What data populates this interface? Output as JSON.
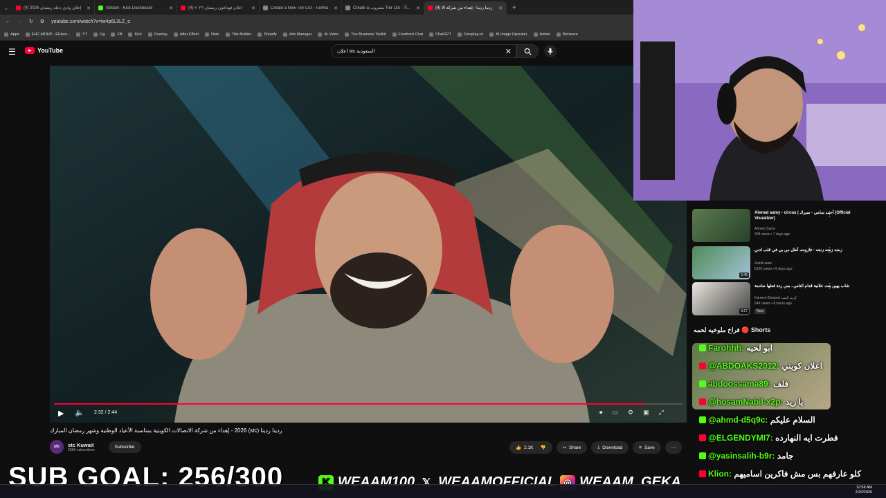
{
  "browser": {
    "tabs": [
      {
        "label": "(4) إعلان وادي دجلة رمضان 2026",
        "color": "#ff0033",
        "active": false
      },
      {
        "label": "Stream - Kick Dashboard",
        "color": "#53fc18",
        "active": false
      },
      {
        "label": "(4) اعلان فودافون رمضان ٢٠٢٦",
        "color": "#ff0033",
        "active": false
      },
      {
        "label": "Create a New Tier List - TierMa",
        "color": "#888888",
        "active": false
      },
      {
        "label": "Create a مشروب Tier List - TierM",
        "color": "#888888",
        "active": false
      },
      {
        "label": "(4) ردينا ردينا - إهداء من شركة الا",
        "color": "#ff0033",
        "active": true
      }
    ],
    "url": "youtube.com/watch?v=iw4p6L3LZ_o",
    "bookmarks": [
      "Apps",
      "EHC-MOHP - EEtest...",
      "YT",
      "Gg",
      "FB",
      "Kick",
      "Overlay",
      "After Effect",
      "Note",
      "Title Builder",
      "Shopify",
      "Ads Manager",
      "AI Video",
      "The Business Toolkit",
      "Forefront Chat",
      "ChatGPT",
      "Foreplay.co",
      "AI Image Upscaler",
      "Anime",
      "Behance"
    ]
  },
  "youtube": {
    "logo": "YouTube",
    "search_value": "اعلان stc السعودية",
    "player": {
      "time": "2:32 / 2:44",
      "progress": 0.94
    },
    "video_title": "ردينا ردينا (stc) 2026 - إهداء من شركة الاتصالات الكويتية بمناسبة الأعياد الوطنية وشهر رمضان المبارك",
    "channel": {
      "name": "stc Kuwait",
      "subscribers": "258K subscribers",
      "subscribe_label": "Subscribe"
    },
    "actions": {
      "likes": "2.1K",
      "share": "Share",
      "download": "Download",
      "save": "Save"
    },
    "recommendations": [
      {
        "title": "Ahmed samy - circus | أحمد سامي - سيرك (Official Visualizer)",
        "channel": "Ahmed Samy",
        "meta": "328 views • 7 days ago",
        "duration": ""
      },
      {
        "title": "زنجه زنجه زنجه - فازونت أطل من بي في قلب ادني",
        "channel": "ZainKuwait",
        "meta": "612K views • 8 days ago",
        "duration": "2:45"
      },
      {
        "title": "شاب يهين بنت علانية قدام الناس.. بس ردة فعلها صادمة",
        "channel": "Kareem Elsayed كريم السيد",
        "meta": "54K views • 8 hours ago",
        "duration": "9:27",
        "badge": "New"
      }
    ]
  },
  "chat": {
    "header": "فراخ ملوخيه لحمه 🔴 Shorts",
    "messages": [
      {
        "user": "Farohhh:",
        "text": "ابو لحيه",
        "color": "#53fc18"
      },
      {
        "user": "@ABDOAKS2012:",
        "text": "اعلان كويتي",
        "color": "#53fc18"
      },
      {
        "user": "abdoossama89:",
        "text": "فلف",
        "color": "#53fc18"
      },
      {
        "user": "@hosamNabil-x2p:",
        "text": "يا زيد",
        "color": "#53fc18"
      },
      {
        "user": "@ahmd-d5q9c:",
        "text": "السلام عليكم",
        "color": "#53fc18"
      },
      {
        "user": "@ELGENDYMI7:",
        "text": "فطرت ايه النهارده",
        "color": "#53fc18"
      },
      {
        "user": "@yasinsalih-b9r:",
        "text": "جامد",
        "color": "#53fc18"
      },
      {
        "user": "Klion:",
        "text": "كلو عارفهم بس مش فاكرين اساميهم",
        "color": "#53fc18"
      }
    ]
  },
  "overlay": {
    "sub_goal": "SUB GOAL: 256/300",
    "kick": "WEAAM100",
    "x": "WEAAMOFFICIAL",
    "instagram": "WEAAM_GEKA"
  },
  "taskbar": {
    "time": "12:58 AM",
    "date": "2/20/2026"
  },
  "colors": {
    "youtube_red": "#ff0033",
    "kick_green": "#53fc18"
  }
}
